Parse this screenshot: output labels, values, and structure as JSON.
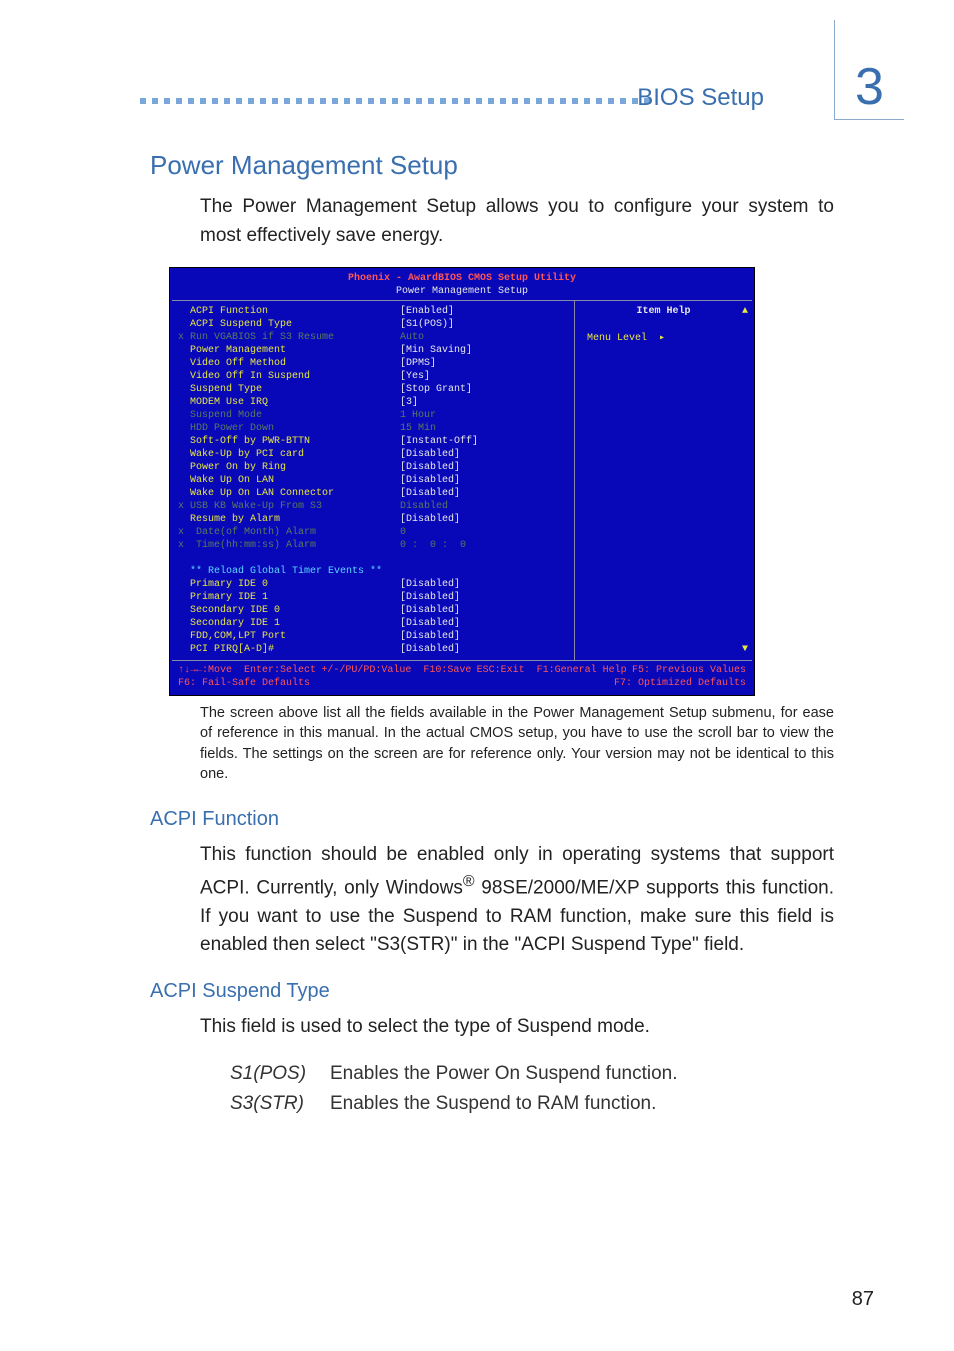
{
  "header": {
    "breadcrumb": "BIOS Setup",
    "chapter": "3"
  },
  "section": {
    "title": "Power Management Setup",
    "intro": "The Power Management Setup allows you to configure your system to most effectively save energy."
  },
  "bios": {
    "title": "Phoenix - AwardBIOS CMOS Setup Utility",
    "subtitle": "Power Management Setup",
    "help_label": "Item Help",
    "menu_level": "Menu Level",
    "rows": [
      {
        "dim": false,
        "x": " ",
        "label": "ACPI Function",
        "value": "[Enabled]"
      },
      {
        "dim": false,
        "x": " ",
        "label": "ACPI Suspend Type",
        "value": "[S1(POS)]"
      },
      {
        "dim": true,
        "x": "x",
        "label": "Run VGABIOS if S3 Resume",
        "value": "Auto"
      },
      {
        "dim": false,
        "x": " ",
        "label": "Power Management",
        "value": "[Min Saving]"
      },
      {
        "dim": false,
        "x": " ",
        "label": "Video Off Method",
        "value": "[DPMS]"
      },
      {
        "dim": false,
        "x": " ",
        "label": "Video Off In Suspend",
        "value": "[Yes]"
      },
      {
        "dim": false,
        "x": " ",
        "label": "Suspend Type",
        "value": "[Stop Grant]"
      },
      {
        "dim": false,
        "x": " ",
        "label": "MODEM Use IRQ",
        "value": "[3]"
      },
      {
        "dim": true,
        "x": " ",
        "label": "Suspend Mode",
        "value": "1 Hour"
      },
      {
        "dim": true,
        "x": " ",
        "label": "HDD Power Down",
        "value": "15 Min"
      },
      {
        "dim": false,
        "x": " ",
        "label": "Soft-Off by PWR-BTTN",
        "value": "[Instant-Off]"
      },
      {
        "dim": false,
        "x": " ",
        "label": "Wake-Up by PCI card",
        "value": "[Disabled]"
      },
      {
        "dim": false,
        "x": " ",
        "label": "Power On by Ring",
        "value": "[Disabled]"
      },
      {
        "dim": false,
        "x": " ",
        "label": "Wake Up On LAN",
        "value": "[Disabled]"
      },
      {
        "dim": false,
        "x": " ",
        "label": "Wake Up On LAN Connector",
        "value": "[Disabled]"
      },
      {
        "dim": true,
        "x": "x",
        "label": "USB KB Wake-Up From S3",
        "value": "Disabled"
      },
      {
        "dim": false,
        "x": " ",
        "label": "Resume by Alarm",
        "value": "[Disabled]"
      },
      {
        "dim": true,
        "x": "x",
        "label": " Date(of Month) Alarm",
        "value": "0"
      },
      {
        "dim": true,
        "x": "x",
        "label": " Time(hh:mm:ss) Alarm",
        "value": "0 :  0 :  0"
      }
    ],
    "reload_header": "** Reload Global Timer Events **",
    "reload_rows": [
      {
        "label": "Primary IDE 0",
        "value": "[Disabled]"
      },
      {
        "label": "Primary IDE 1",
        "value": "[Disabled]"
      },
      {
        "label": "Secondary IDE 0",
        "value": "[Disabled]"
      },
      {
        "label": "Secondary IDE 1",
        "value": "[Disabled]"
      },
      {
        "label": "FDD,COM,LPT Port",
        "value": "[Disabled]"
      },
      {
        "label": "PCI PIRQ[A-D]#",
        "value": "[Disabled]"
      }
    ],
    "footer": {
      "l1a": "↑↓→←:Move  Enter:Select",
      "l1b": "+/-/PU/PD:Value  F10:Save",
      "l1c": "ESC:Exit  F1:General Help",
      "l2a": "F5: Previous Values",
      "l2b": "F6: Fail-Safe Defaults",
      "l2c": "F7: Optimized Defaults"
    }
  },
  "caption": "The screen above list all the fields available in the Power Management Setup submenu, for ease of reference in this manual. In the actual CMOS setup, you have to use the scroll bar to view the fields. The settings on the screen are for reference only. Your version may not be identical to this one.",
  "acpi_function": {
    "title": "ACPI Function",
    "body_a": "This function should be enabled only in operating systems that support ACPI. Currently, only Windows",
    "body_b": " 98SE/2000/ME/XP supports this function. If you want to use the Suspend to RAM function, make sure this field is enabled then select \"S3(STR)\" in the \"ACPI Suspend Type\" field."
  },
  "acpi_suspend": {
    "title": "ACPI Suspend Type",
    "intro": "This field is used to select the type of Suspend mode.",
    "defs": [
      {
        "term": "S1(POS)",
        "desc": "Enables the Power On Suspend function."
      },
      {
        "term": "S3(STR)",
        "desc": "Enables the Suspend to RAM function."
      }
    ]
  },
  "page_number": "87"
}
